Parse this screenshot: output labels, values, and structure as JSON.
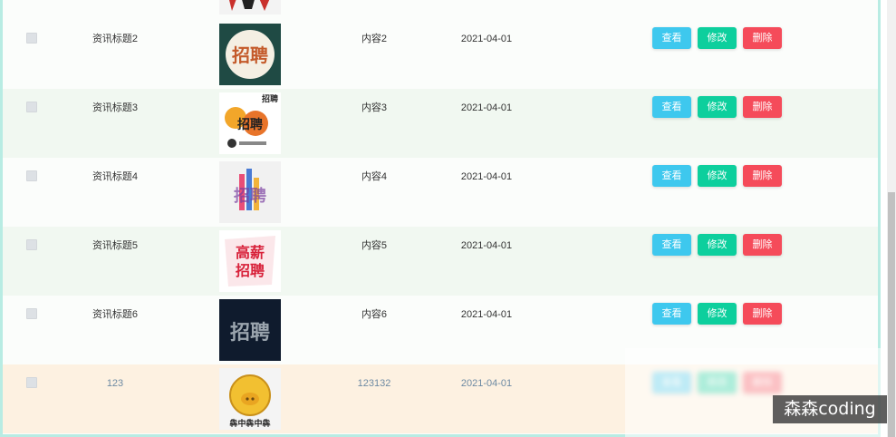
{
  "actions": {
    "view": "查看",
    "edit": "修改",
    "delete": "删除"
  },
  "rows": [
    {
      "title": "资讯标题2",
      "content": "内容2",
      "date": "2021-04-01"
    },
    {
      "title": "资讯标题3",
      "content": "内容3",
      "date": "2021-04-01"
    },
    {
      "title": "资讯标题4",
      "content": "内容4",
      "date": "2021-04-01"
    },
    {
      "title": "资讯标题5",
      "content": "内容5",
      "date": "2021-04-01"
    },
    {
      "title": "资讯标题6",
      "content": "内容6",
      "date": "2021-04-01"
    },
    {
      "title": "123",
      "content": "123132",
      "date": "2021-04-01"
    }
  ],
  "thumb_text": {
    "r0": "招聘",
    "r1_top": "招聘",
    "r1_main": "招聘",
    "r2": "招聘",
    "r3_top": "高薪",
    "r3_bottom": "招聘",
    "r4": "招聘",
    "r5": "犇中犇中犇"
  },
  "colors": {
    "view": "#3ec8ee",
    "edit": "#0dcf9d",
    "delete": "#f54b5a",
    "highlight_row": "#fdf1e1",
    "alt_row": "#f1f8f1"
  },
  "watermark": "森森coding"
}
